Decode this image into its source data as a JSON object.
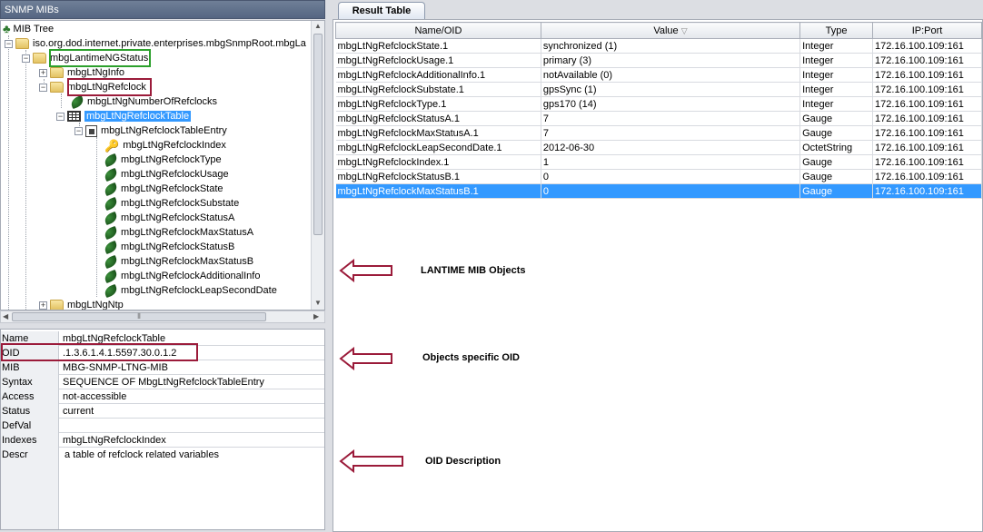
{
  "left_panel": {
    "title": "SNMP MIBs",
    "tree": {
      "root": "MIB Tree",
      "path_node": "iso.org.dod.internet.private.enterprises.mbgSnmpRoot.mbgLa",
      "status_node": "mbgLantimeNGStatus",
      "info_node": "mbgLtNgInfo",
      "refclock_node": "mbgLtNgRefclock",
      "num_refclocks": "mbgLtNgNumberOfRefclocks",
      "table_node": "mbgLtNgRefclockTable",
      "entry_node": "mbgLtNgRefclockTableEntry",
      "children": [
        "mbgLtNgRefclockIndex",
        "mbgLtNgRefclockType",
        "mbgLtNgRefclockUsage",
        "mbgLtNgRefclockState",
        "mbgLtNgRefclockSubstate",
        "mbgLtNgRefclockStatusA",
        "mbgLtNgRefclockMaxStatusA",
        "mbgLtNgRefclockStatusB",
        "mbgLtNgRefclockMaxStatusB",
        "mbgLtNgRefclockAdditionalInfo",
        "mbgLtNgRefclockLeapSecondDate"
      ],
      "ntp_node": "mbgLtNgNtp"
    },
    "properties": [
      {
        "key": "Name",
        "value": "mbgLtNgRefclockTable"
      },
      {
        "key": "OID",
        "value": ".1.3.6.1.4.1.5597.30.0.1.2"
      },
      {
        "key": "MIB",
        "value": "MBG-SNMP-LTNG-MIB"
      },
      {
        "key": "Syntax",
        "value": "SEQUENCE OF MbgLtNgRefclockTableEntry"
      },
      {
        "key": "Access",
        "value": "not-accessible"
      },
      {
        "key": "Status",
        "value": "current"
      },
      {
        "key": "DefVal",
        "value": ""
      },
      {
        "key": "Indexes",
        "value": "mbgLtNgRefclockIndex"
      },
      {
        "key": "Descr",
        "value": "a table of refclock related variables"
      }
    ]
  },
  "right_panel": {
    "tab_label": "Result Table",
    "columns": [
      "Name/OID",
      "Value",
      "Type",
      "IP:Port"
    ],
    "value_sort_glyph": "▽",
    "rows": [
      [
        "mbgLtNgRefclockState.1",
        "synchronized (1)",
        "Integer",
        "172.16.100.109:161"
      ],
      [
        "mbgLtNgRefclockUsage.1",
        "primary (3)",
        "Integer",
        "172.16.100.109:161"
      ],
      [
        "mbgLtNgRefclockAdditionalInfo.1",
        "notAvailable (0)",
        "Integer",
        "172.16.100.109:161"
      ],
      [
        "mbgLtNgRefclockSubstate.1",
        "gpsSync (1)",
        "Integer",
        "172.16.100.109:161"
      ],
      [
        "mbgLtNgRefclockType.1",
        "gps170 (14)",
        "Integer",
        "172.16.100.109:161"
      ],
      [
        "mbgLtNgRefclockStatusA.1",
        "7",
        "Gauge",
        "172.16.100.109:161"
      ],
      [
        "mbgLtNgRefclockMaxStatusA.1",
        "7",
        "Gauge",
        "172.16.100.109:161"
      ],
      [
        "mbgLtNgRefclockLeapSecondDate.1",
        "2012-06-30",
        "OctetString",
        "172.16.100.109:161"
      ],
      [
        "mbgLtNgRefclockIndex.1",
        "1",
        "Gauge",
        "172.16.100.109:161"
      ],
      [
        "mbgLtNgRefclockStatusB.1",
        "0",
        "Gauge",
        "172.16.100.109:161"
      ],
      [
        "mbgLtNgRefclockMaxStatusB.1",
        "0",
        "Gauge",
        "172.16.100.109:161"
      ]
    ],
    "selected_row_index": 10
  },
  "annotations": {
    "objects_label": "LANTIME MIB Objects",
    "oid_label": "Objects specific OID",
    "descr_label": "OID Description"
  },
  "colors": {
    "header_bg": "#5f6f8a",
    "selection": "#3399ff",
    "green_box": "#2ca02c",
    "red_box": "#9b1b3a",
    "arrow": "#9b1b3a"
  }
}
